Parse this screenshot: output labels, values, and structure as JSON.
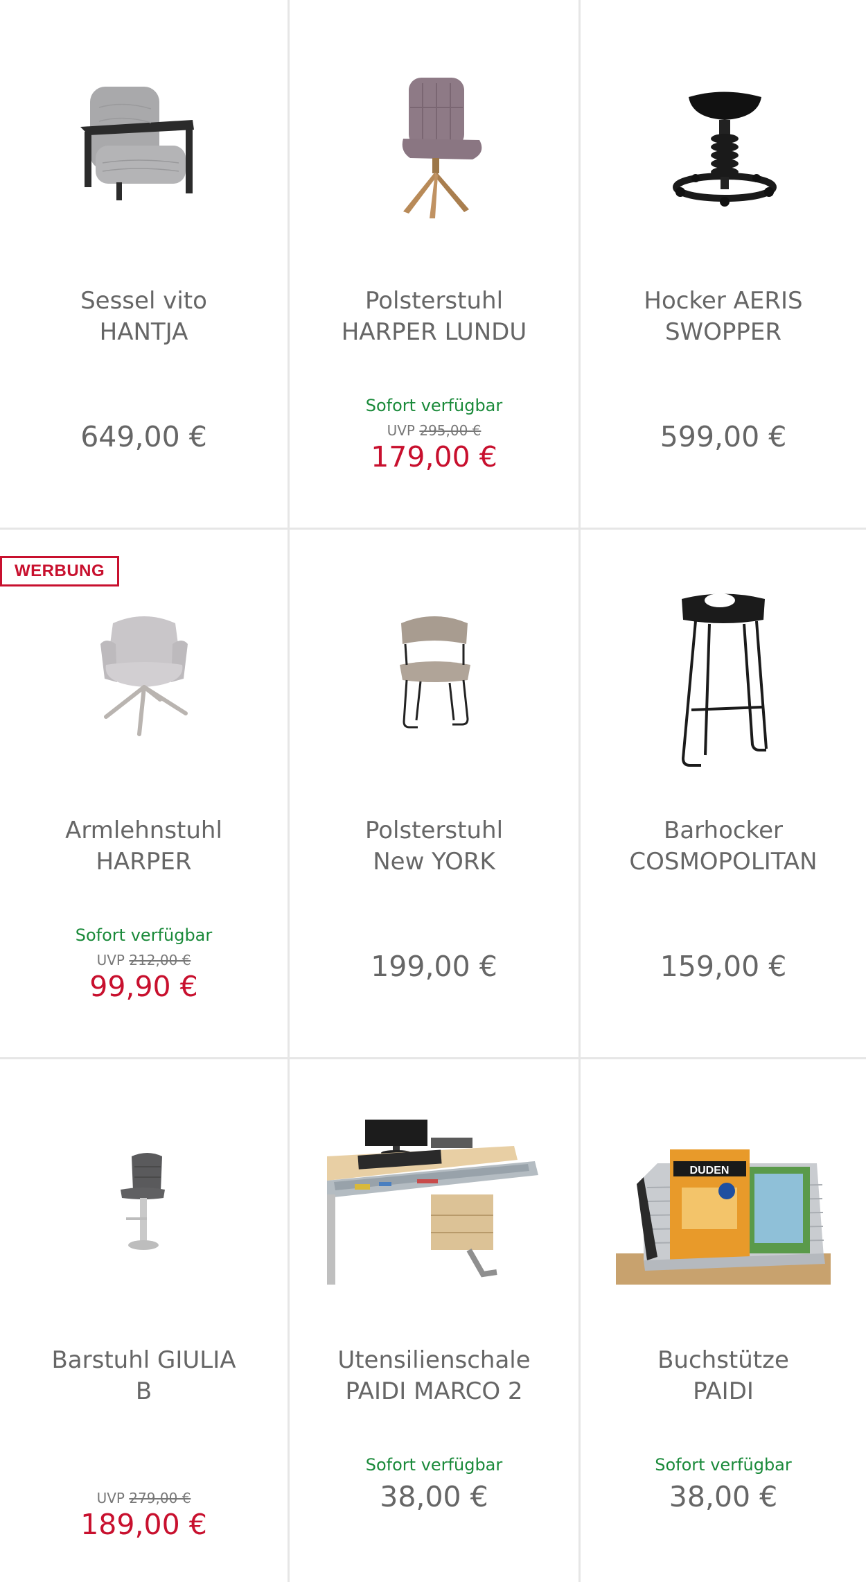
{
  "products": [
    {
      "name_line1": "Sessel vito",
      "name_line2": "HANTJA",
      "availability": "",
      "uvp_label": "",
      "uvp_old": "",
      "price": "649,00 €",
      "badge": "",
      "image": "armchair-grey-image"
    },
    {
      "name_line1": "Polsterstuhl",
      "name_line2": "HARPER LUNDU",
      "availability": "Sofort verfügbar",
      "uvp_label": "UVP",
      "uvp_old": "295,00 €",
      "price": "179,00 €",
      "badge": "",
      "image": "upholstered-chair-mauve-image"
    },
    {
      "name_line1": "Hocker AERIS",
      "name_line2": "SWOPPER",
      "availability": "",
      "uvp_label": "",
      "uvp_old": "",
      "price": "599,00 €",
      "badge": "",
      "image": "swopper-stool-image"
    },
    {
      "name_line1": "Armlehnstuhl",
      "name_line2": "HARPER",
      "availability": "Sofort verfügbar",
      "uvp_label": "UVP",
      "uvp_old": "212,00 €",
      "price": "99,90 €",
      "badge": "WERBUNG",
      "image": "armrest-chair-image"
    },
    {
      "name_line1": "Polsterstuhl",
      "name_line2": "New YORK",
      "availability": "",
      "uvp_label": "",
      "uvp_old": "",
      "price": "199,00 €",
      "badge": "",
      "image": "skid-chair-image"
    },
    {
      "name_line1": "Barhocker",
      "name_line2": "COSMOPOLITAN",
      "availability": "",
      "uvp_label": "",
      "uvp_old": "",
      "price": "159,00 €",
      "badge": "",
      "image": "bar-stool-image"
    },
    {
      "name_line1": "Barstuhl GIULIA",
      "name_line2": "B",
      "availability": "",
      "uvp_label": "UVP",
      "uvp_old": "279,00 €",
      "price": "189,00 €",
      "badge": "",
      "image": "bar-chair-image"
    },
    {
      "name_line1": "Utensilienschale",
      "name_line2": "PAIDI MARCO 2",
      "availability": "Sofort verfügbar",
      "uvp_label": "",
      "uvp_old": "",
      "price": "38,00 €",
      "badge": "",
      "image": "desk-drawer-tray-image"
    },
    {
      "name_line1": "Buchstütze",
      "name_line2": "PAIDI",
      "availability": "Sofort verfügbar",
      "uvp_label": "",
      "uvp_old": "",
      "price": "38,00 €",
      "badge": "",
      "image": "book-stand-image"
    }
  ],
  "book_cover_text": "DUDEN",
  "colors": {
    "sale_red": "#c8102e",
    "availability_green": "#1a8a3a",
    "text_grey": "#666666",
    "divider": "#e6e6e6"
  }
}
